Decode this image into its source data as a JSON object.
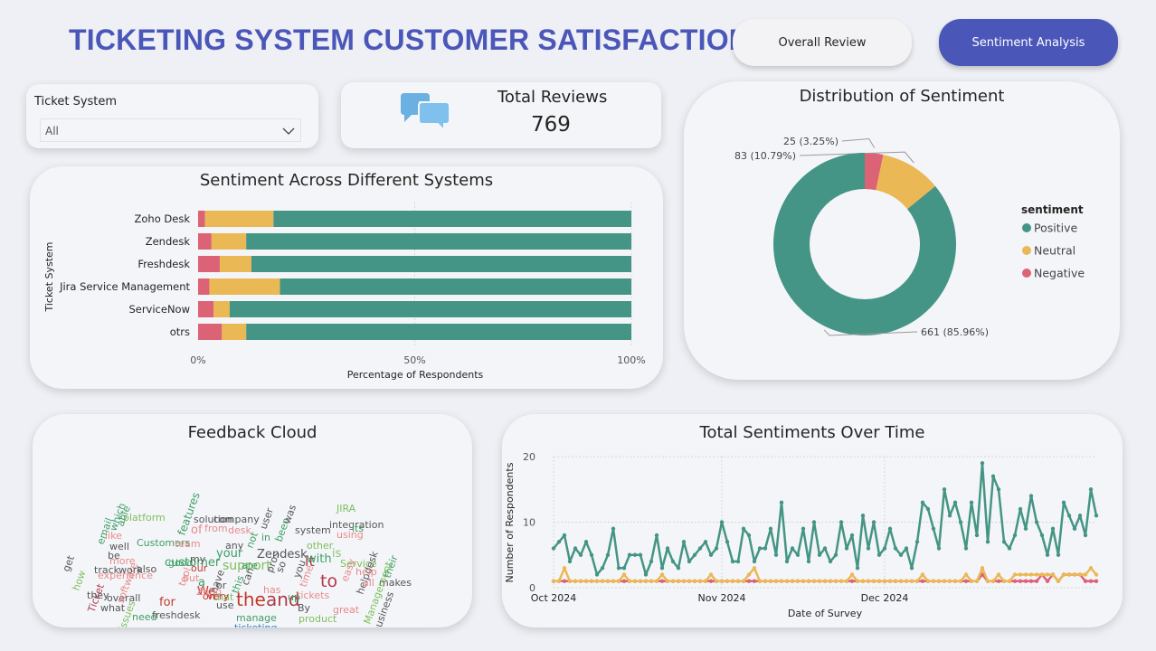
{
  "header": {
    "title": "TICKETING SYSTEM CUSTOMER SATISFACTION"
  },
  "nav": {
    "overall_label": "Overall Review",
    "sentiment_label": "Sentiment Analysis"
  },
  "filter": {
    "label": "Ticket System",
    "value": "All"
  },
  "kpi": {
    "label": "Total Reviews",
    "value": "769",
    "icon": "chat-bubbles-icon"
  },
  "colors": {
    "positive": "#449585",
    "neutral": "#eab855",
    "negative": "#dc6275",
    "accent": "#4a57b8"
  },
  "sentiment_by_system": {
    "title": "Sentiment Across Different Systems",
    "type": "bar",
    "ylabel": "Ticket System",
    "xlabel": "Percentage of Respondents",
    "x_ticks": [
      "0%",
      "50%",
      "100%"
    ],
    "categories": [
      "Zoho Desk",
      "Zendesk",
      "Freshdesk",
      "Jira Service Management",
      "ServiceNow",
      "otrs"
    ],
    "series": [
      {
        "name": "Negative",
        "values": [
          1.6,
          3.1,
          5.0,
          2.6,
          3.6,
          5.5
        ]
      },
      {
        "name": "Neutral",
        "values": [
          15.8,
          8.0,
          7.3,
          16.3,
          3.7,
          5.6
        ]
      },
      {
        "name": "Positive",
        "values": [
          82.6,
          88.9,
          87.7,
          81.1,
          92.7,
          88.9
        ]
      }
    ]
  },
  "distribution": {
    "title": "Distribution of Sentiment",
    "type": "pie",
    "legend_title": "sentiment",
    "slices": [
      {
        "name": "Positive",
        "value": 661,
        "label": "661 (85.96%)"
      },
      {
        "name": "Neutral",
        "value": 83,
        "label": "83 (10.79%)"
      },
      {
        "name": "Negative",
        "value": 25,
        "label": "25 (3.25%)"
      }
    ]
  },
  "cloud": {
    "title": "Feedback Cloud",
    "words": [
      {
        "t": "the",
        "c": "#c0392b",
        "s": 20
      },
      {
        "t": "and",
        "c": "#b03a48",
        "s": 20
      },
      {
        "t": "to",
        "c": "#b03a48",
        "s": 19
      },
      {
        "t": "it",
        "c": "#b03a48",
        "s": 16
      },
      {
        "t": "support",
        "c": "#7dbf5c",
        "s": 14
      },
      {
        "t": "customer",
        "c": "#3d9e64",
        "s": 13
      },
      {
        "t": "Zendesk",
        "c": "#555",
        "s": 13
      },
      {
        "t": "with",
        "c": "#3d9e64",
        "s": 13
      },
      {
        "t": "your",
        "c": "#3d9e64",
        "s": 13
      },
      {
        "t": "of",
        "c": "#e88a8a",
        "s": 13
      },
      {
        "t": "is",
        "c": "#8cc66c",
        "s": 13
      },
      {
        "t": "a",
        "c": "#3d9e64",
        "s": 13
      },
      {
        "t": "for",
        "c": "#c0392b",
        "s": 13
      },
      {
        "t": "We",
        "c": "#c0392b",
        "s": 13
      },
      {
        "t": "features",
        "c": "#3d9e64",
        "s": 12
      },
      {
        "t": "platform",
        "c": "#7dbf5c",
        "s": 11
      },
      {
        "t": "Customers",
        "c": "#3d9e64",
        "s": 11
      },
      {
        "t": "solution",
        "c": "#555",
        "s": 11
      },
      {
        "t": "company",
        "c": "#555",
        "s": 11
      },
      {
        "t": "integration",
        "c": "#555",
        "s": 11
      },
      {
        "t": "system",
        "c": "#555",
        "s": 11
      },
      {
        "t": "JIRA",
        "c": "#7dbf5c",
        "s": 11
      },
      {
        "t": "its",
        "c": "#3d9e64",
        "s": 11
      },
      {
        "t": "using",
        "c": "#e88a8a",
        "s": 11
      },
      {
        "t": "other",
        "c": "#7dbf5c",
        "s": 11
      },
      {
        "t": "Service",
        "c": "#7dbf5c",
        "s": 11
      },
      {
        "t": "their",
        "c": "#3d9e64",
        "s": 11
      },
      {
        "t": "makes",
        "c": "#555",
        "s": 11
      },
      {
        "t": "helpdesk",
        "c": "#555",
        "s": 11
      },
      {
        "t": "tickets",
        "c": "#e88a8a",
        "s": 11
      },
      {
        "t": "great",
        "c": "#e88a8a",
        "s": 11
      },
      {
        "t": "product",
        "c": "#7dbf5c",
        "s": 11
      },
      {
        "t": "Management",
        "c": "#7dbf5c",
        "s": 11
      },
      {
        "t": "business",
        "c": "#555",
        "s": 11
      },
      {
        "t": "easy",
        "c": "#e88a8a",
        "s": 11
      },
      {
        "t": "help",
        "c": "#e88a8a",
        "s": 11
      },
      {
        "t": "By",
        "c": "#555",
        "s": 11
      },
      {
        "t": "up",
        "c": "#3d9e64",
        "s": 11
      },
      {
        "t": "manage",
        "c": "#3d9e64",
        "s": 11
      },
      {
        "t": "ticketing",
        "c": "#2e86c1",
        "s": 11
      },
      {
        "t": "better",
        "c": "#555",
        "s": 11
      },
      {
        "t": "freshdesk",
        "c": "#555",
        "s": 11
      },
      {
        "t": "need",
        "c": "#3d9e64",
        "s": 11
      },
      {
        "t": "issues",
        "c": "#7dbf5c",
        "s": 11
      },
      {
        "t": "what",
        "c": "#555",
        "s": 11
      },
      {
        "t": "Ticket",
        "c": "#b03a48",
        "s": 11
      },
      {
        "t": "overall",
        "c": "#555",
        "s": 11
      },
      {
        "t": "software",
        "c": "#e88a8a",
        "s": 11
      },
      {
        "t": "work",
        "c": "#555",
        "s": 11
      },
      {
        "t": "more",
        "c": "#e88a8a",
        "s": 11
      },
      {
        "t": "also",
        "c": "#555",
        "s": 11
      },
      {
        "t": "be",
        "c": "#555",
        "s": 11
      },
      {
        "t": "well",
        "c": "#555",
        "s": 11
      },
      {
        "t": "like",
        "c": "#e88a8a",
        "s": 11
      },
      {
        "t": "track",
        "c": "#555",
        "s": 11
      },
      {
        "t": "get",
        "c": "#555",
        "s": 11
      },
      {
        "t": "email",
        "c": "#3d9e64",
        "s": 11
      },
      {
        "t": "how",
        "c": "#7dbf5c",
        "s": 11
      },
      {
        "t": "they",
        "c": "#555",
        "s": 11
      },
      {
        "t": "which",
        "c": "#3d9e64",
        "s": 11
      },
      {
        "t": "able",
        "c": "#3d9e64",
        "s": 11
      },
      {
        "t": "experience",
        "c": "#e88a8a",
        "s": 11
      },
      {
        "t": "team",
        "c": "#e88a8a",
        "s": 11
      },
      {
        "t": "good",
        "c": "#3d9e64",
        "s": 11
      },
      {
        "t": "our",
        "c": "#c0392b",
        "s": 11
      },
      {
        "t": "have",
        "c": "#555",
        "s": 11
      },
      {
        "t": "from",
        "c": "#e88a8a",
        "s": 11
      },
      {
        "t": "desk",
        "c": "#e88a8a",
        "s": 11
      },
      {
        "t": "user",
        "c": "#555",
        "s": 11
      },
      {
        "t": "been",
        "c": "#3d9e64",
        "s": 11
      },
      {
        "t": "was",
        "c": "#555",
        "s": 11
      },
      {
        "t": "pros",
        "c": "#555",
        "s": 11
      },
      {
        "t": "are",
        "c": "#3d9e64",
        "s": 11
      },
      {
        "t": "can",
        "c": "#555",
        "s": 11
      },
      {
        "t": "has",
        "c": "#e88a8a",
        "s": 11
      },
      {
        "t": "that",
        "c": "#7dbf5c",
        "s": 11
      },
      {
        "t": "this",
        "c": "#3d9e64",
        "s": 11
      },
      {
        "t": "my",
        "c": "#555",
        "s": 11
      },
      {
        "t": "use",
        "c": "#555",
        "s": 11
      },
      {
        "t": "very",
        "c": "#c0392b",
        "s": 11
      },
      {
        "t": "on",
        "c": "#c0392b",
        "s": 11
      },
      {
        "t": "but",
        "c": "#e88a8a",
        "s": 11
      },
      {
        "t": "tool",
        "c": "#e88a8a",
        "s": 11
      },
      {
        "t": "not",
        "c": "#3d9e64",
        "s": 11
      },
      {
        "t": "so",
        "c": "#555",
        "s": 11
      },
      {
        "t": "in",
        "c": "#3d9e64",
        "s": 11
      },
      {
        "t": "or",
        "c": "#555",
        "s": 11
      },
      {
        "t": "any",
        "c": "#555",
        "s": 11
      },
      {
        "t": "Zoho",
        "c": "#e88a8a",
        "s": 11
      },
      {
        "t": "all",
        "c": "#e88a8a",
        "s": 11
      },
      {
        "t": "you",
        "c": "#555",
        "s": 11
      },
      {
        "t": "time",
        "c": "#e88a8a",
        "s": 11
      }
    ]
  },
  "timeline": {
    "title": "Total Sentiments Over Time",
    "type": "line",
    "xlabel": "Date of Survey",
    "ylabel": "Number of Respondents",
    "x_ticks": [
      "Oct 2024",
      "Nov 2024",
      "Dec 2024"
    ],
    "y_ticks": [
      "0",
      "10",
      "20"
    ],
    "ylim": [
      0,
      20
    ],
    "x_start": "2024-10-01",
    "series": [
      {
        "name": "Positive",
        "values": [
          6,
          7,
          8,
          4,
          6,
          5,
          7,
          5,
          2,
          3,
          5,
          9,
          3,
          3,
          5,
          5,
          5,
          2,
          4,
          8,
          3,
          6,
          4,
          3,
          7,
          4,
          5,
          6,
          7,
          5,
          6,
          10,
          7,
          4,
          4,
          9,
          8,
          4,
          6,
          6,
          9,
          5,
          13,
          4,
          6,
          5,
          9,
          4,
          10,
          5,
          6,
          4,
          5,
          10,
          6,
          8,
          3,
          11,
          6,
          10,
          5,
          6,
          9,
          6,
          5,
          6,
          3,
          7,
          13,
          12,
          9,
          6,
          15,
          11,
          13,
          10,
          6,
          13,
          8,
          19,
          7,
          17,
          15,
          7,
          6,
          8,
          12,
          9,
          14,
          10,
          8,
          5,
          9,
          5,
          13,
          11,
          9,
          11,
          8,
          15,
          11
        ]
      },
      {
        "name": "Neutral",
        "values": [
          1,
          1,
          3,
          1,
          1,
          1,
          1,
          1,
          1,
          1,
          1,
          1,
          1,
          2,
          1,
          1,
          1,
          1,
          1,
          1,
          2,
          1,
          1,
          1,
          1,
          1,
          1,
          1,
          1,
          2,
          1,
          1,
          1,
          1,
          1,
          1,
          2,
          3,
          1,
          1,
          1,
          1,
          1,
          1,
          1,
          1,
          1,
          1,
          1,
          1,
          1,
          1,
          1,
          1,
          1,
          2,
          1,
          1,
          1,
          1,
          1,
          1,
          1,
          1,
          1,
          1,
          1,
          1,
          2,
          1,
          1,
          1,
          1,
          1,
          1,
          1,
          2,
          1,
          1,
          3,
          1,
          1,
          2,
          1,
          1,
          2,
          2,
          2,
          2,
          2,
          2,
          2,
          2,
          1,
          2,
          2,
          2,
          2,
          2,
          3,
          2
        ]
      },
      {
        "name": "Negative",
        "values": [
          1,
          1,
          1,
          1,
          1,
          1,
          1,
          1,
          1,
          1,
          1,
          1,
          1,
          1,
          1,
          1,
          1,
          1,
          1,
          1,
          1,
          1,
          1,
          1,
          1,
          1,
          1,
          1,
          1,
          1,
          1,
          1,
          1,
          1,
          1,
          1,
          1,
          1,
          1,
          1,
          1,
          1,
          1,
          1,
          1,
          1,
          1,
          1,
          1,
          1,
          1,
          1,
          1,
          1,
          1,
          1,
          1,
          1,
          1,
          1,
          1,
          1,
          1,
          1,
          1,
          1,
          1,
          1,
          1,
          1,
          1,
          1,
          1,
          1,
          1,
          1,
          1,
          1,
          1,
          2,
          1,
          1,
          1,
          1,
          1,
          1,
          1,
          1,
          1,
          1,
          2,
          1,
          2,
          1,
          2,
          2,
          2,
          2,
          1,
          1,
          1
        ]
      }
    ]
  }
}
